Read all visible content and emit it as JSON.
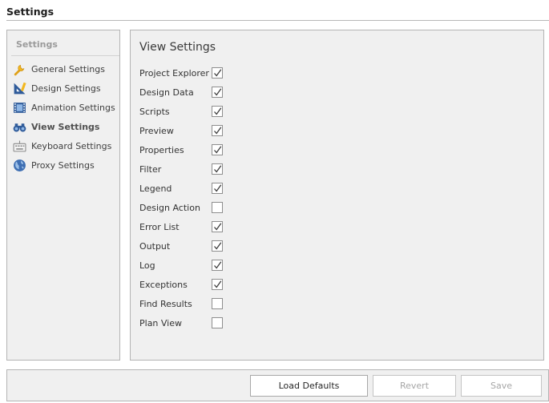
{
  "window": {
    "title": "Settings"
  },
  "sidebar": {
    "header": "Settings",
    "items": [
      {
        "label": "General Settings",
        "icon": "wrench-icon",
        "active": false
      },
      {
        "label": "Design Settings",
        "icon": "triangle-ruler-icon",
        "active": false
      },
      {
        "label": "Animation Settings",
        "icon": "film-icon",
        "active": false
      },
      {
        "label": "View Settings",
        "icon": "binoculars-icon",
        "active": true
      },
      {
        "label": "Keyboard Settings",
        "icon": "keyboard-icon",
        "active": false
      },
      {
        "label": "Proxy Settings",
        "icon": "globe-icon",
        "active": false
      }
    ]
  },
  "main": {
    "title": "View Settings",
    "options": [
      {
        "label": "Project Explorer",
        "checked": true
      },
      {
        "label": "Design Data",
        "checked": true
      },
      {
        "label": "Scripts",
        "checked": true
      },
      {
        "label": "Preview",
        "checked": true
      },
      {
        "label": "Properties",
        "checked": true
      },
      {
        "label": "Filter",
        "checked": true
      },
      {
        "label": "Legend",
        "checked": true
      },
      {
        "label": "Design Action",
        "checked": false
      },
      {
        "label": "Error List",
        "checked": true
      },
      {
        "label": "Output",
        "checked": true
      },
      {
        "label": "Log",
        "checked": true
      },
      {
        "label": "Exceptions",
        "checked": true
      },
      {
        "label": "Find Results",
        "checked": false
      },
      {
        "label": "Plan View",
        "checked": false
      }
    ]
  },
  "footer": {
    "load_defaults": "Load Defaults",
    "revert": "Revert",
    "save": "Save"
  },
  "colors": {
    "panel_bg": "#f0f0f0",
    "border": "#b4b4b4",
    "disabled_text": "#a6a6a6"
  }
}
